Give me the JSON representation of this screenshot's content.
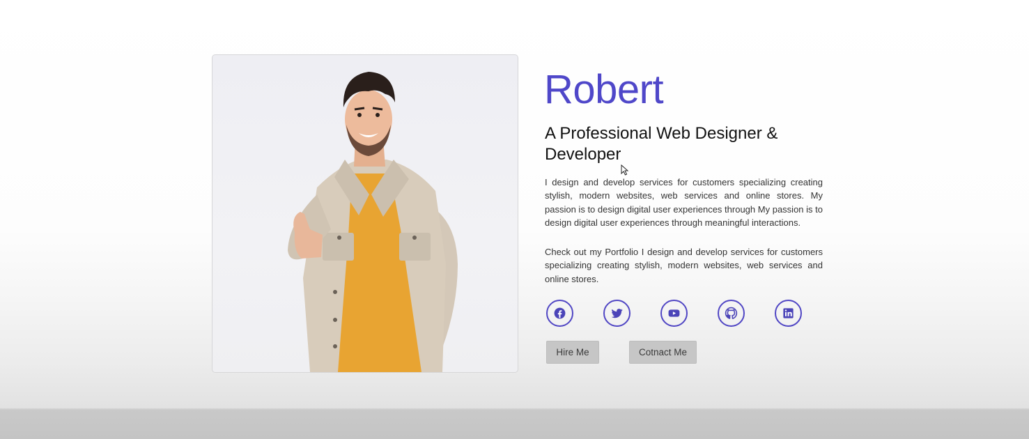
{
  "profile": {
    "name": "Robert",
    "title": "A Professional Web Designer & Developer",
    "bio_paragraphs": [
      "I design and develop services for customers specializing creating stylish, modern websites, web services and online stores. My passion is to design digital user experiences through My passion is to design digital user experiences through meaningful interactions.",
      "Check out my Portfolio I design and develop services for customers specializing creating stylish, modern websites, web services and online stores."
    ]
  },
  "socials": [
    {
      "icon": "facebook-icon"
    },
    {
      "icon": "twitter-icon"
    },
    {
      "icon": "youtube-icon"
    },
    {
      "icon": "github-icon"
    },
    {
      "icon": "linkedin-icon"
    }
  ],
  "buttons": {
    "hire": "Hire Me",
    "contact": "Cotnact Me"
  },
  "colors": {
    "accent": "#4f47c9",
    "button_bg": "#c6c6c6"
  }
}
